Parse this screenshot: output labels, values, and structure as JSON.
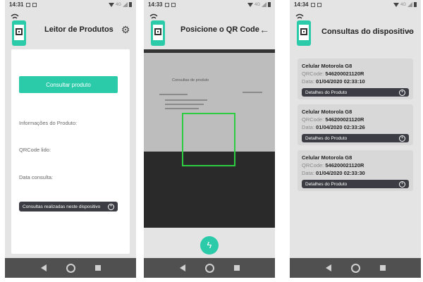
{
  "status": {
    "screen1_time": "14:31",
    "screen2_time": "14:33",
    "screen3_time": "14:34",
    "network": "4G"
  },
  "screen1": {
    "title": "Leitor de Produtos",
    "consult_button": "Consultar produto",
    "product_info_label": "Informações do Produto:",
    "qrcode_label": "QRCode lido:",
    "date_label": "Data consulta:",
    "history_button": "Consultas realizadas neste dispositivo"
  },
  "screen2": {
    "title": "Posicione o QR Code",
    "camera_preview_text": "Consultas de produto"
  },
  "screen3": {
    "title": "Consultas do dispositivo",
    "qr_key": "QRCode:",
    "date_key": "Data:",
    "details_button": "Detalhes do Produto",
    "records": [
      {
        "name": "Celular Motorola G8",
        "qrcode": "546200021120R",
        "date": "01/04/2020 02:33:10"
      },
      {
        "name": "Celular Motorola G8",
        "qrcode": "546200021120R",
        "date": "01/04/2020 02:33:26"
      },
      {
        "name": "Celular Motorola G8",
        "qrcode": "546200021120R",
        "date": "01/04/2020 02:33:30"
      }
    ]
  },
  "colors": {
    "accent": "#2bcbaa",
    "dark_button": "#3c3d44",
    "scan_frame": "#2ecc40",
    "navbar": "#505050"
  },
  "icons": [
    "nfc-signal-icon",
    "phone-qr-icon",
    "gear-icon",
    "arrow-left-icon",
    "circle-plus-icon",
    "flash-icon",
    "back-icon",
    "home-icon",
    "recents-icon"
  ]
}
